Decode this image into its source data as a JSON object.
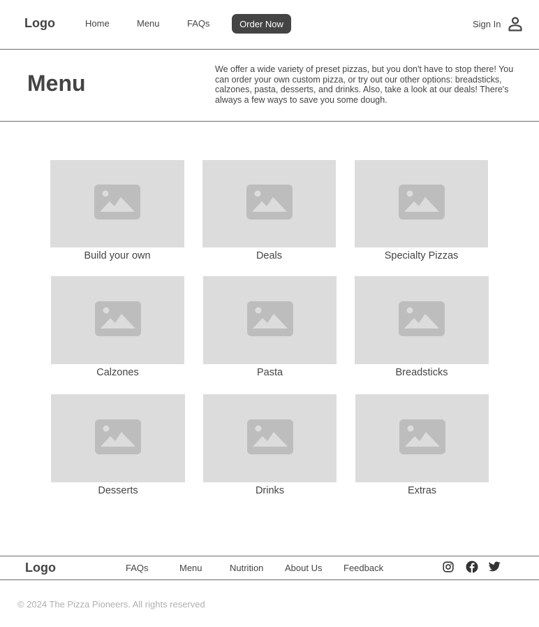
{
  "header": {
    "logo": "Logo",
    "nav": [
      {
        "label": "Home"
      },
      {
        "label": "Menu"
      },
      {
        "label": "FAQs"
      }
    ],
    "cta": "Order Now",
    "sign_in": "Sign In",
    "icons": {
      "account": "user-icon"
    }
  },
  "hero": {
    "title": "Menu",
    "description": "We offer a wide variety of preset pizzas, but you don't have to stop there! You can order your own custom pizza, or try out our other options: breadsticks, calzones, pasta, desserts, and drinks. Also, take a look at our deals! There's always a few ways to save you some dough."
  },
  "categories": [
    {
      "label": "Build your own"
    },
    {
      "label": "Deals"
    },
    {
      "label": "Specialty Pizzas"
    },
    {
      "label": "Calzones"
    },
    {
      "label": "Pasta"
    },
    {
      "label": "Breadsticks"
    },
    {
      "label": "Desserts"
    },
    {
      "label": "Drinks"
    },
    {
      "label": "Extras"
    }
  ],
  "footer": {
    "logo": "Logo",
    "links": [
      {
        "label": "FAQs"
      },
      {
        "label": "Menu"
      },
      {
        "label": "Nutrition"
      },
      {
        "label": "About Us"
      },
      {
        "label": "Feedback"
      }
    ],
    "social_icons": [
      "instagram-icon",
      "facebook-icon",
      "twitter-icon"
    ],
    "copyright": "© 2024 The Pizza Pioneers. All rights reserved"
  },
  "colors": {
    "dark": "#444444",
    "placeholder_bg": "#dcdcdc",
    "placeholder_icon": "#bdbdbd",
    "muted_text": "#b0b0b0"
  }
}
